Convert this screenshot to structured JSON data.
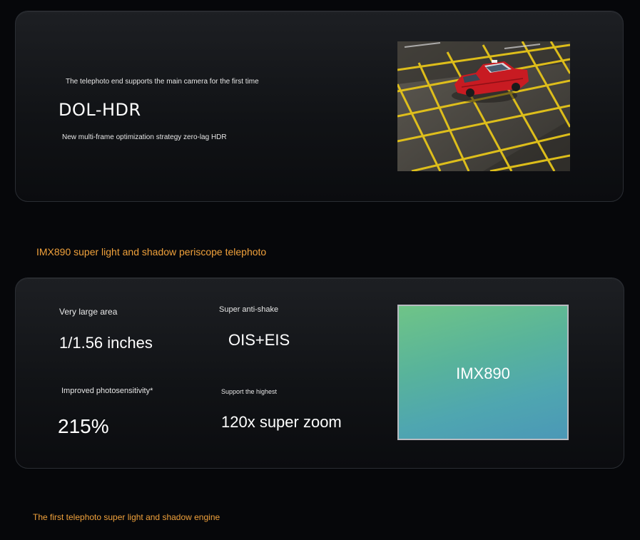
{
  "hdr_card": {
    "kicker": "The telephoto end supports the main camera for the first time",
    "title": "DOL-HDR",
    "subtitle": "New multi-frame optimization strategy zero-lag HDR"
  },
  "sensor_section": {
    "heading": "IMX890 super light and shadow periscope telephoto",
    "specs": [
      {
        "label": "Very large area",
        "value": "1/1.56 inches"
      },
      {
        "label": "Super anti-shake",
        "value": "OIS+EIS"
      },
      {
        "label": "Improved photosensitivity*",
        "value": "215%"
      },
      {
        "label": "Support the highest",
        "value": "120x super zoom"
      }
    ],
    "chip_label": "IMX890"
  },
  "engine_section": {
    "heading": "The first telephoto super light and shadow engine"
  },
  "colors": {
    "accent": "#f0a13b",
    "card_border": "#2a2d33",
    "chip_green": "#6fc487",
    "chip_blue": "#4b98b7",
    "taxi_red": "#c81b22",
    "road_yellow": "#e6c51a"
  },
  "icons": {
    "photo": "red-taxi-on-yellow-box-junction-photo"
  }
}
